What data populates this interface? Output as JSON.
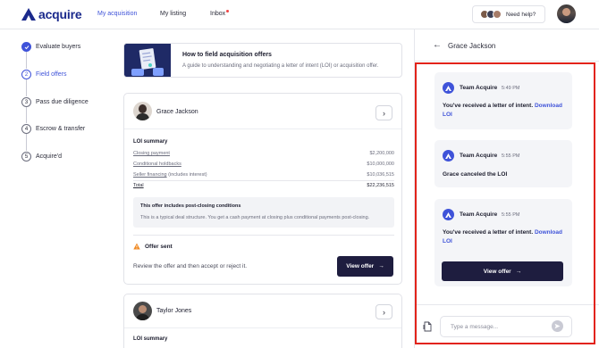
{
  "header": {
    "logo_text": "acquire",
    "nav": [
      "My acquisition",
      "My listing",
      "Inbox"
    ],
    "help_label": "Need help?"
  },
  "steps": [
    {
      "number": "",
      "label": "Evaluate buyers",
      "state": "done"
    },
    {
      "number": "2",
      "label": "Field offers",
      "state": "current"
    },
    {
      "number": "3",
      "label": "Pass due diligence",
      "state": "todo"
    },
    {
      "number": "4",
      "label": "Escrow & transfer",
      "state": "todo"
    },
    {
      "number": "5",
      "label": "Acquire'd",
      "state": "todo"
    }
  ],
  "guide": {
    "title": "How to field acquisition offers",
    "subtitle": "A guide to understanding and negotiating a letter of intent (LOI) or acquisition offer."
  },
  "offer": {
    "buyer": "Grace Jackson",
    "loi_title": "LOI summary",
    "rows": [
      {
        "label": "Closing payment",
        "note": "",
        "value": "$2,200,000"
      },
      {
        "label": "Conditional holdbacks",
        "note": "",
        "value": "$10,000,000"
      },
      {
        "label": "Seller financing",
        "note": "(includes interest)",
        "value": "$10,036,515"
      },
      {
        "label": "Total",
        "note": "",
        "value": "$22,236,515"
      }
    ],
    "conditions_title": "This offer includes post-closing conditions",
    "conditions_text": "This is a typical deal structure. You get a cash payment at closing plus conditional payments post-closing.",
    "status": "Offer sent",
    "review_text": "Review the offer and then accept or reject it.",
    "view_offer_label": "View offer"
  },
  "offer2": {
    "buyer": "Taylor Jones",
    "loi_title": "LOI summary"
  },
  "chat": {
    "title": "Grace Jackson",
    "messages": [
      {
        "sender": "Team Acquire",
        "time": "5:49 PM",
        "text": "You've received a letter of intent.",
        "link": "Download LOI"
      },
      {
        "sender": "Team Acquire",
        "time": "5:55 PM",
        "text": "Grace canceled the LOI",
        "link": ""
      },
      {
        "sender": "Team Acquire",
        "time": "5:55 PM",
        "text": "You've received a letter of intent.",
        "link": "Download LOI",
        "button": "View offer"
      }
    ],
    "placeholder": "Type a message..."
  },
  "colors": {
    "brand": "#1b2a8c",
    "accent": "#3f53d9",
    "button_dark": "#1e1d3f",
    "highlight": "#e2231a"
  }
}
